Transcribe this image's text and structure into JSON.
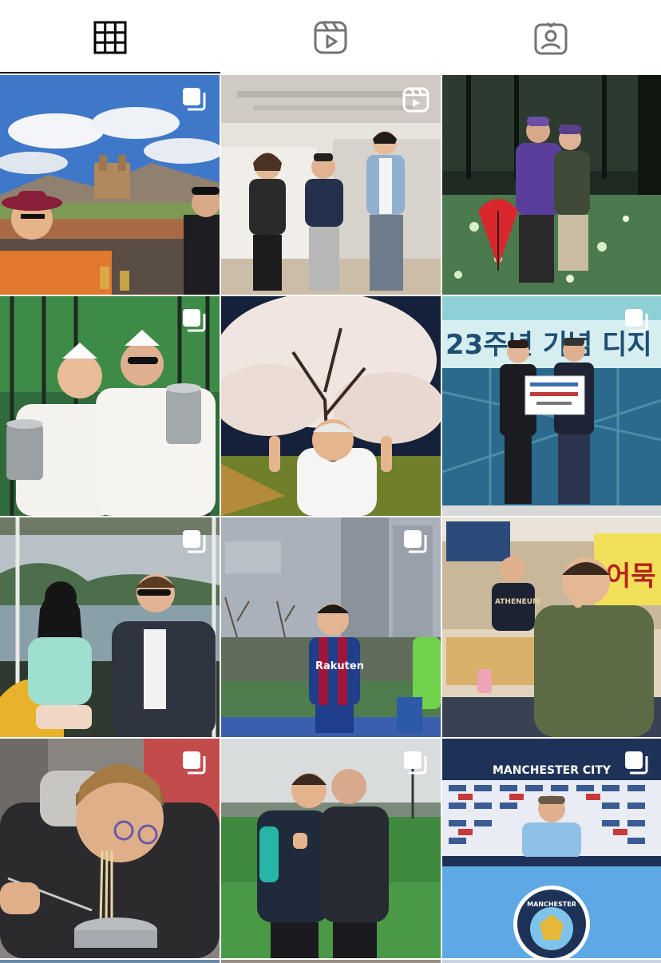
{
  "tabs": [
    {
      "id": "posts",
      "icon": "grid-icon",
      "active": true
    },
    {
      "id": "reels",
      "icon": "reels-icon",
      "active": false
    },
    {
      "id": "tagged",
      "icon": "tagged-user-icon",
      "active": false
    }
  ],
  "posts": [
    {
      "row": 1,
      "col": 1,
      "badge": "carousel-icon"
    },
    {
      "row": 1,
      "col": 2,
      "badge": "reel-icon"
    },
    {
      "row": 1,
      "col": 3,
      "badge": ""
    },
    {
      "row": 2,
      "col": 1,
      "badge": "carousel-icon"
    },
    {
      "row": 2,
      "col": 2,
      "badge": ""
    },
    {
      "row": 2,
      "col": 3,
      "badge": "carousel-icon",
      "sign_text": "23주년 기념 디지"
    },
    {
      "row": 3,
      "col": 1,
      "badge": "carousel-icon"
    },
    {
      "row": 3,
      "col": 2,
      "badge": "carousel-icon",
      "jersey_text": "Rakuten"
    },
    {
      "row": 3,
      "col": 3,
      "badge": "",
      "sign_text": "어묵",
      "shirt_text": "ATHENEUM"
    },
    {
      "row": 4,
      "col": 1,
      "badge": "carousel-icon"
    },
    {
      "row": 4,
      "col": 2,
      "badge": "carousel-icon"
    },
    {
      "row": 4,
      "col": 3,
      "badge": "carousel-icon",
      "banner_text": "MANCHESTER CITY",
      "crest_text": "MANCHESTER"
    }
  ],
  "colors": {
    "active_tab": "#000000",
    "inactive_tab": "#737373",
    "badge": "#ffffff"
  }
}
